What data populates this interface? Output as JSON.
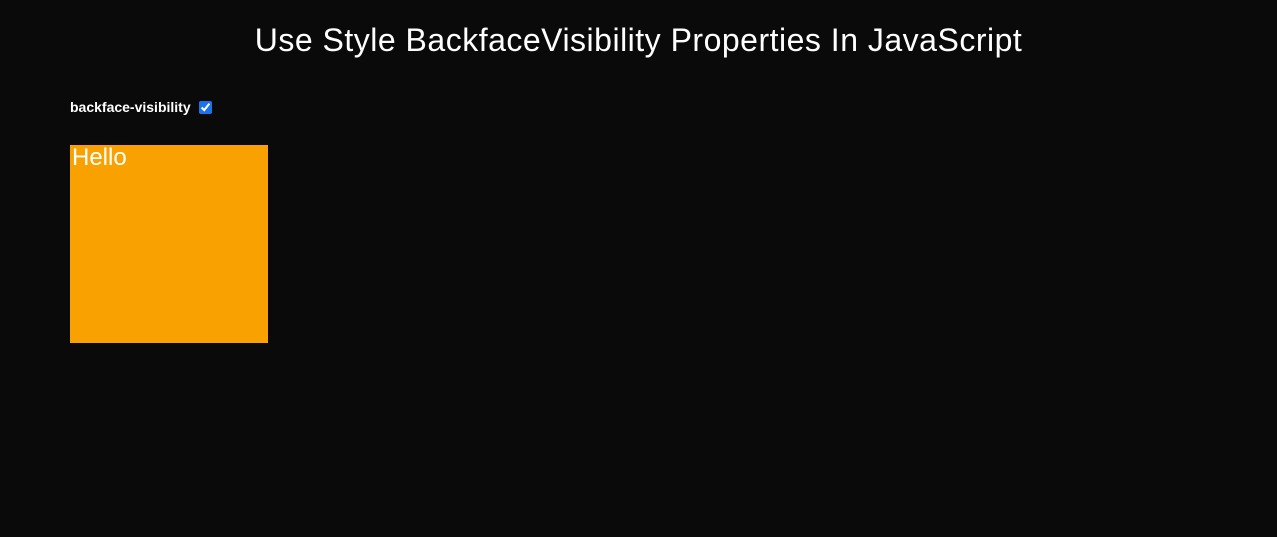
{
  "header": {
    "title": "Use Style BackfaceVisibility Properties In JavaScript"
  },
  "controls": {
    "backface_label": "backface-visibility",
    "backface_checked": true
  },
  "box": {
    "text": "Hello",
    "background_color": "#f9a100"
  }
}
